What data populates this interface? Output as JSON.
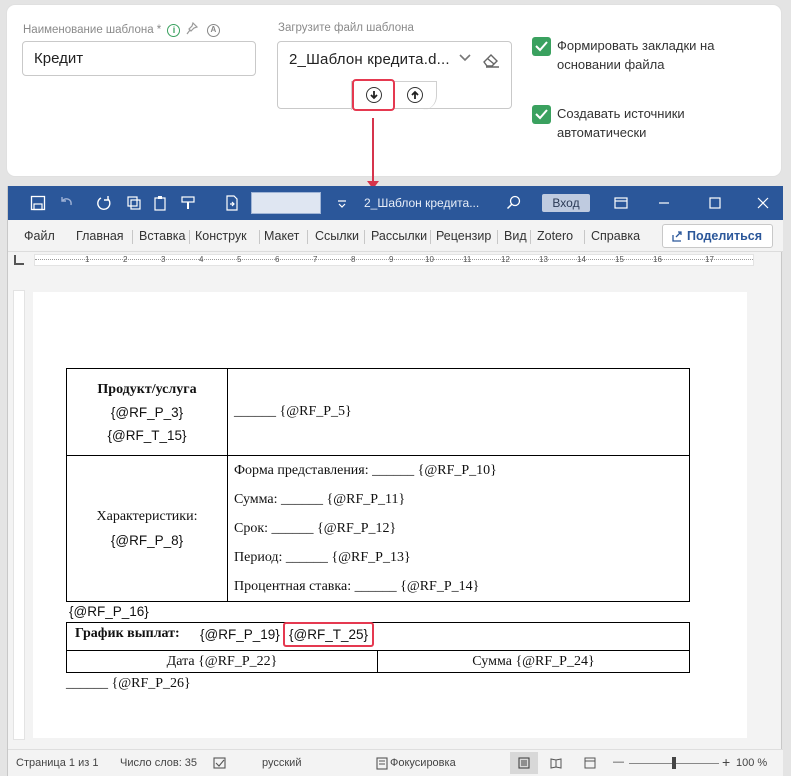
{
  "form": {
    "template_name_label": "Наименование шаблона *",
    "template_name_value": "Кредит",
    "upload_label": "Загрузите файл шаблона",
    "file_name": "2_Шаблон кредита.d...",
    "checkbox_bookmarks": "Формировать закладки на основании файла",
    "checkbox_bookmarks_line1": "Формировать закладки на",
    "checkbox_bookmarks_line2": "основании файла",
    "checkbox_sources_line1": "Создавать источники",
    "checkbox_sources_line2": "автоматически",
    "accent_green": "#3aa15f",
    "highlight_red": "#e53950"
  },
  "word": {
    "window_title": "2_Шаблон кредита...",
    "signin": "Вход",
    "ribbon_tabs": [
      "Файл",
      "Главная",
      "Вставка",
      "Конструк",
      "Макет",
      "Ссылки",
      "Рассылки",
      "Рецензир",
      "Вид",
      "Zotero",
      "Справка"
    ],
    "share": "Поделиться",
    "ruler_marks": [
      "1",
      "2",
      "3",
      "4",
      "5",
      "6",
      "7",
      "8",
      "9",
      "10",
      "11",
      "12",
      "13",
      "14",
      "15",
      "16",
      "17"
    ],
    "status": {
      "page": "Страница 1 из 1",
      "words": "Число слов: 35",
      "language": "русский",
      "focus": "Фокусировка",
      "zoom": "100 %"
    },
    "title_color": "#2b579a"
  },
  "doc": {
    "product_label": "Продукт/услуга",
    "product_tag1": "{@RF_P_3}",
    "product_tag2": "{@RF_T_15}",
    "product_value": "______ {@RF_P_5}",
    "char_label": "Характеристики:",
    "char_tag": "{@RF_P_8}",
    "char_lines": [
      "Форма представления: ______ {@RF_P_10}",
      "Сумма: ______ {@RF_P_11}",
      "Срок: ______ {@RF_P_12}",
      "Период: ______ {@RF_P_13}",
      "Процентная ставка: ______ {@RF_P_14}"
    ],
    "after_table": "{@RF_P_16}",
    "schedule_label": "График выплат:",
    "schedule_tag1": "{@RF_P_19}",
    "schedule_tag2": "{@RF_T_25}",
    "col_date": "Дата {@RF_P_22}",
    "col_sum": "Сумма {@RF_P_24}",
    "footer_line": "______ {@RF_P_26}"
  }
}
